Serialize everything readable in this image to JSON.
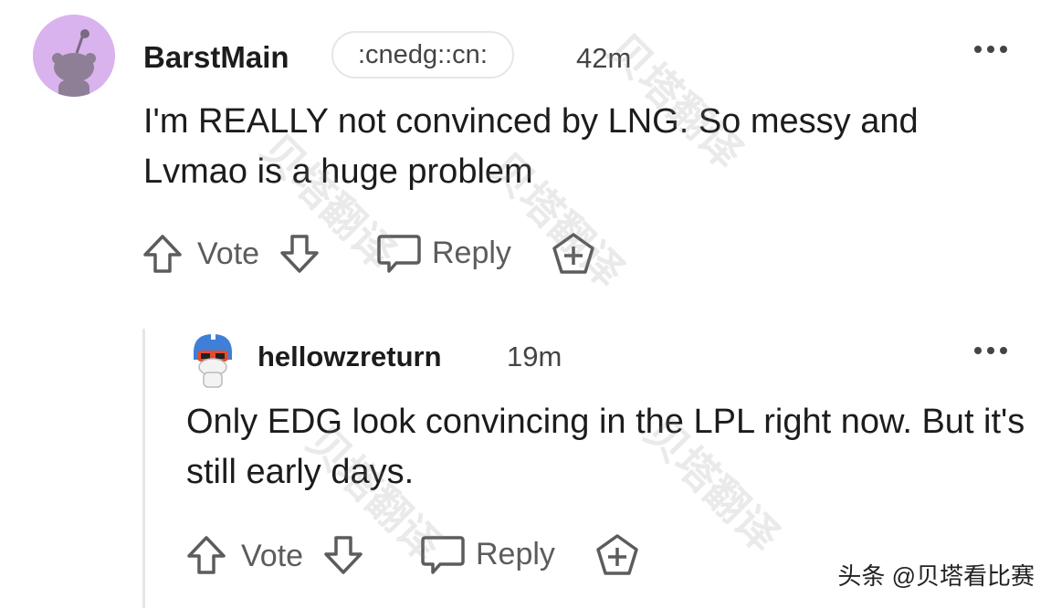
{
  "comments": [
    {
      "author": "BarstMain",
      "flair": ":cnedg::cn:",
      "time": "42m",
      "body": "I'm REALLY not convinced by LNG. So messy and Lvmao is a huge problem",
      "actions": {
        "vote": "Vote",
        "reply": "Reply"
      }
    },
    {
      "author": "hellowzreturn",
      "time": "19m",
      "body": "Only EDG look convincing in the LPL right now. But it's still early days.",
      "actions": {
        "vote": "Vote",
        "reply": "Reply"
      }
    }
  ],
  "icons": {
    "upvote": "arrow-up-icon",
    "downvote": "arrow-down-icon",
    "reply": "speech-bubble-icon",
    "award": "award-plus-icon",
    "more": "more-options-icon"
  },
  "watermark": {
    "text": "贝塔翻译",
    "credit": "头条 @贝塔看比赛"
  }
}
